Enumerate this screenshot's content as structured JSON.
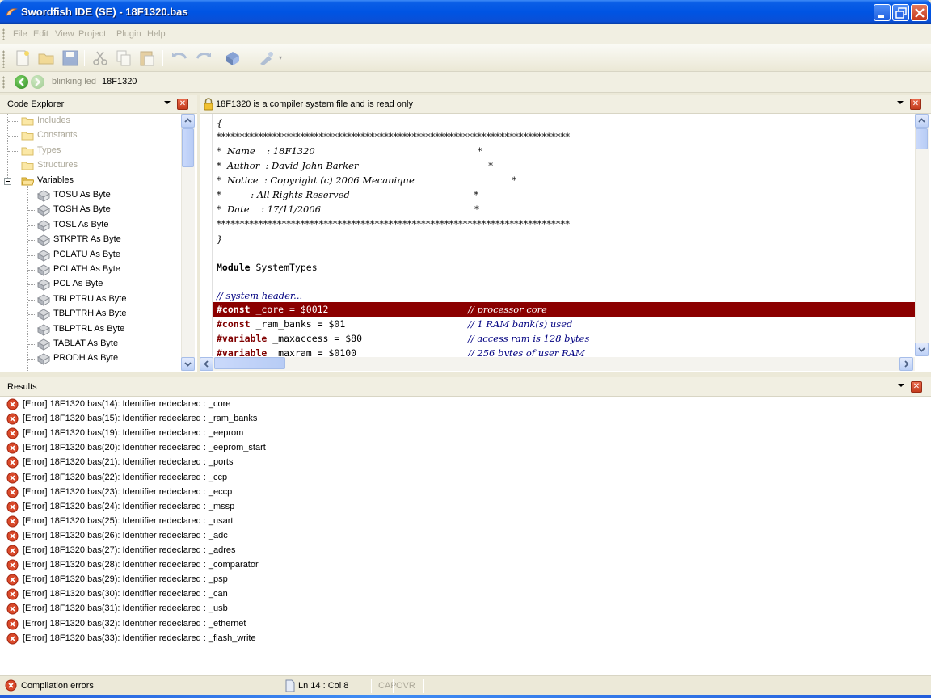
{
  "window": {
    "title": "Swordfish IDE (SE) - 18F1320.bas"
  },
  "menu": {
    "items": [
      "File",
      "Edit",
      "View",
      "Project",
      "Plugin",
      "Help"
    ]
  },
  "toolbar": {
    "icons": [
      "new-file-icon",
      "open-folder-icon",
      "save-icon",
      "cut-icon",
      "copy-icon",
      "paste-icon",
      "undo-icon",
      "redo-icon",
      "compile-icon",
      "program-icon"
    ]
  },
  "nav": {
    "crumbs": [
      "blinking led",
      "18F1320"
    ]
  },
  "code_explorer": {
    "title": "Code Explorer",
    "folders": [
      "Includes",
      "Constants",
      "Types",
      "Structures",
      "Variables"
    ],
    "variables": [
      "TOSU As Byte",
      "TOSH As Byte",
      "TOSL As Byte",
      "STKPTR As Byte",
      "PCLATU As Byte",
      "PCLATH As Byte",
      "PCL As Byte",
      "TBLPTRU As Byte",
      "TBLPTRH As Byte",
      "TBLPTRL As Byte",
      "TABLAT As Byte",
      "PRODH As Byte"
    ]
  },
  "editor": {
    "banner": "18F1320 is a compiler system file and is read only",
    "lines": {
      "l1": "{",
      "l2": "****************************************************************************",
      "l3": "*  Name    : 18F1320                                                       *",
      "l4": "*  Author  : David John Barker                                            *",
      "l5": "*  Notice  : Copyright (c) 2006 Mecanique                                 *",
      "l6": "*          : All Rights Reserved                                          *",
      "l7": "*  Date    : 17/11/2006                                                    *",
      "l8": "****************************************************************************",
      "l9": "}",
      "l10_kw": "Module",
      "l10_rest": " SystemTypes",
      "l11": "// system header...",
      "l12_kw": "#const",
      "l12_rest": " _core = $0012",
      "l12_cmt": "// processor core",
      "l13_kw": "#const",
      "l13_rest": " _ram_banks = $01",
      "l13_cmt": "// 1 RAM bank(s) used",
      "l14_kw": "#variable",
      "l14_rest": " _maxaccess = $80",
      "l14_cmt": "// access ram is 128 bytes",
      "l15_kw": "#variable",
      "l15_rest": " _maxram = $0100",
      "l15_cmt": "// 256 bytes of user RAM"
    }
  },
  "results": {
    "title": "Results",
    "items": [
      "[Error] 18F1320.bas(14): Identifier redeclared : _core",
      "[Error] 18F1320.bas(15): Identifier redeclared : _ram_banks",
      "[Error] 18F1320.bas(19): Identifier redeclared : _eeprom",
      "[Error] 18F1320.bas(20): Identifier redeclared : _eeprom_start",
      "[Error] 18F1320.bas(21): Identifier redeclared : _ports",
      "[Error] 18F1320.bas(22): Identifier redeclared : _ccp",
      "[Error] 18F1320.bas(23): Identifier redeclared : _eccp",
      "[Error] 18F1320.bas(24): Identifier redeclared : _mssp",
      "[Error] 18F1320.bas(25): Identifier redeclared : _usart",
      "[Error] 18F1320.bas(26): Identifier redeclared : _adc",
      "[Error] 18F1320.bas(27): Identifier redeclared : _adres",
      "[Error] 18F1320.bas(28): Identifier redeclared : _comparator",
      "[Error] 18F1320.bas(29): Identifier redeclared : _psp",
      "[Error] 18F1320.bas(30): Identifier redeclared : _can",
      "[Error] 18F1320.bas(31): Identifier redeclared : _usb",
      "[Error] 18F1320.bas(32): Identifier redeclared : _ethernet",
      "[Error] 18F1320.bas(33): Identifier redeclared : _flash_write"
    ]
  },
  "status": {
    "message": "Compilation errors",
    "position": "Ln 14 : Col 8",
    "caps": "CAP",
    "ovr": "OVR"
  },
  "colors": {
    "highlight_line": "#8b0000",
    "keyword": "#800000",
    "titlebar": "#0054e3"
  }
}
